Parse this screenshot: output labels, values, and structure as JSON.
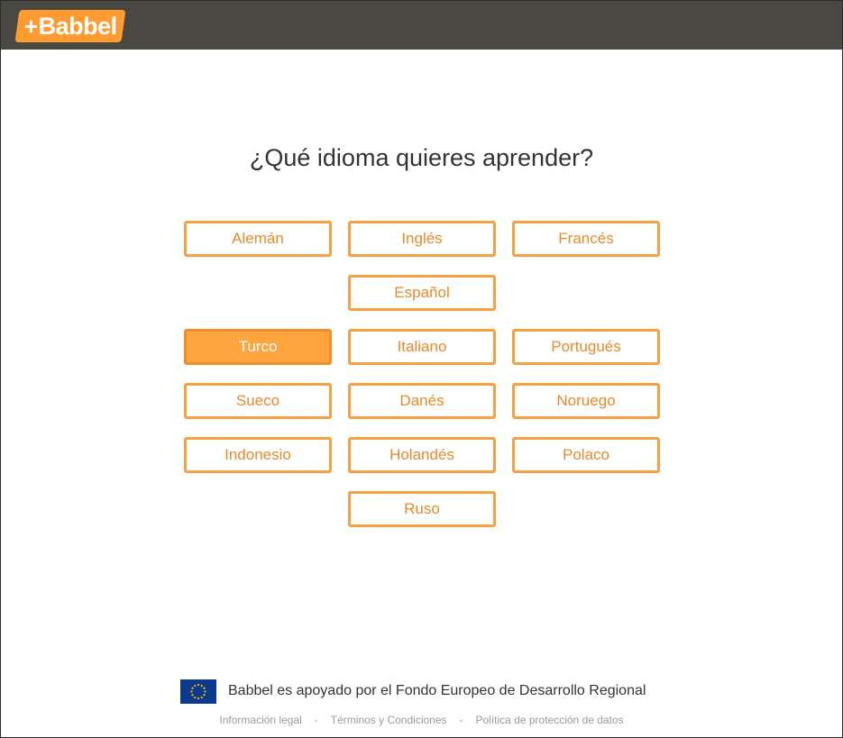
{
  "header": {
    "logo_text": "Babbel",
    "logo_plus": "+",
    "brand_color": "#ff9b30",
    "bar_color": "#4a4843"
  },
  "main": {
    "heading": "¿Qué idioma quieres aprender?",
    "languages": [
      {
        "label": "Alemán"
      },
      {
        "label": "Inglés"
      },
      {
        "label": "Francés"
      },
      {
        "label": "Español"
      },
      {
        "label": "Turco",
        "selected": true
      },
      {
        "label": "Italiano"
      },
      {
        "label": "Portugués"
      },
      {
        "label": "Sueco"
      },
      {
        "label": "Danés"
      },
      {
        "label": "Noruego"
      },
      {
        "label": "Indonesio"
      },
      {
        "label": "Holandés"
      },
      {
        "label": "Polaco"
      },
      {
        "label": "Ruso"
      }
    ]
  },
  "footer": {
    "eu_text": "Babbel es apoyado por el Fondo Europeo de Desarrollo Regional",
    "links": [
      "Información legal",
      "Términos y Condiciones",
      "Política de protección de datos"
    ],
    "separator": "-"
  }
}
